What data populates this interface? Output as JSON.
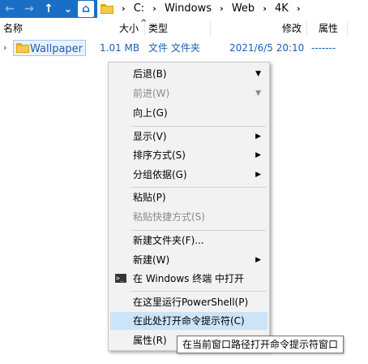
{
  "address": {
    "nav": {
      "back": "←",
      "forward": "→",
      "up": "↑",
      "dropdown": "⌄",
      "home": "⌂"
    },
    "crumbs": [
      "C:",
      "Windows",
      "Web",
      "4K"
    ],
    "separator": "›"
  },
  "columns": {
    "name": "名称",
    "size": "大小",
    "type": "类型",
    "modified": "修改",
    "attributes": "属性",
    "sort_indicator": "^"
  },
  "row": {
    "expander": "›",
    "name": "Wallpaper",
    "size": "1.01 MB",
    "type": "文件 文件夹",
    "modified": "2021/6/5 20:10",
    "attributes": "-------"
  },
  "menu": {
    "items": [
      {
        "label": "后退(B)",
        "enabled": true,
        "arrow": "▼"
      },
      {
        "label": "前进(W)",
        "enabled": false,
        "arrow": "▼"
      },
      {
        "label": "向上(G)",
        "enabled": true
      },
      {
        "label": "显示(V)",
        "enabled": true,
        "arrow": "▶"
      },
      {
        "label": "排序方式(S)",
        "enabled": true,
        "arrow": "▶"
      },
      {
        "label": "分组依据(G)",
        "enabled": true,
        "arrow": "▶"
      },
      {
        "label": "粘贴(P)",
        "enabled": true
      },
      {
        "label": "粘贴快捷方式(S)",
        "enabled": false
      },
      {
        "label": "新建文件夹(F)...",
        "enabled": true
      },
      {
        "label": "新建(W)",
        "enabled": true,
        "arrow": "▶"
      },
      {
        "label": "在 Windows 终端 中打开",
        "enabled": true,
        "icon": "terminal-icon"
      },
      {
        "label": "在这里运行PowerShell(P)",
        "enabled": true
      },
      {
        "label": "在此处打开命令提示符(C)",
        "enabled": true,
        "highlighted": true
      },
      {
        "label": "属性(R)",
        "enabled": true
      }
    ]
  },
  "tooltip": {
    "text": "在当前窗口路径打开命令提示符窗口"
  },
  "colors": {
    "address_bar": "#1a6fc4",
    "menu_highlight": "#cce4f7",
    "link_blue": "#1a5fb4"
  }
}
